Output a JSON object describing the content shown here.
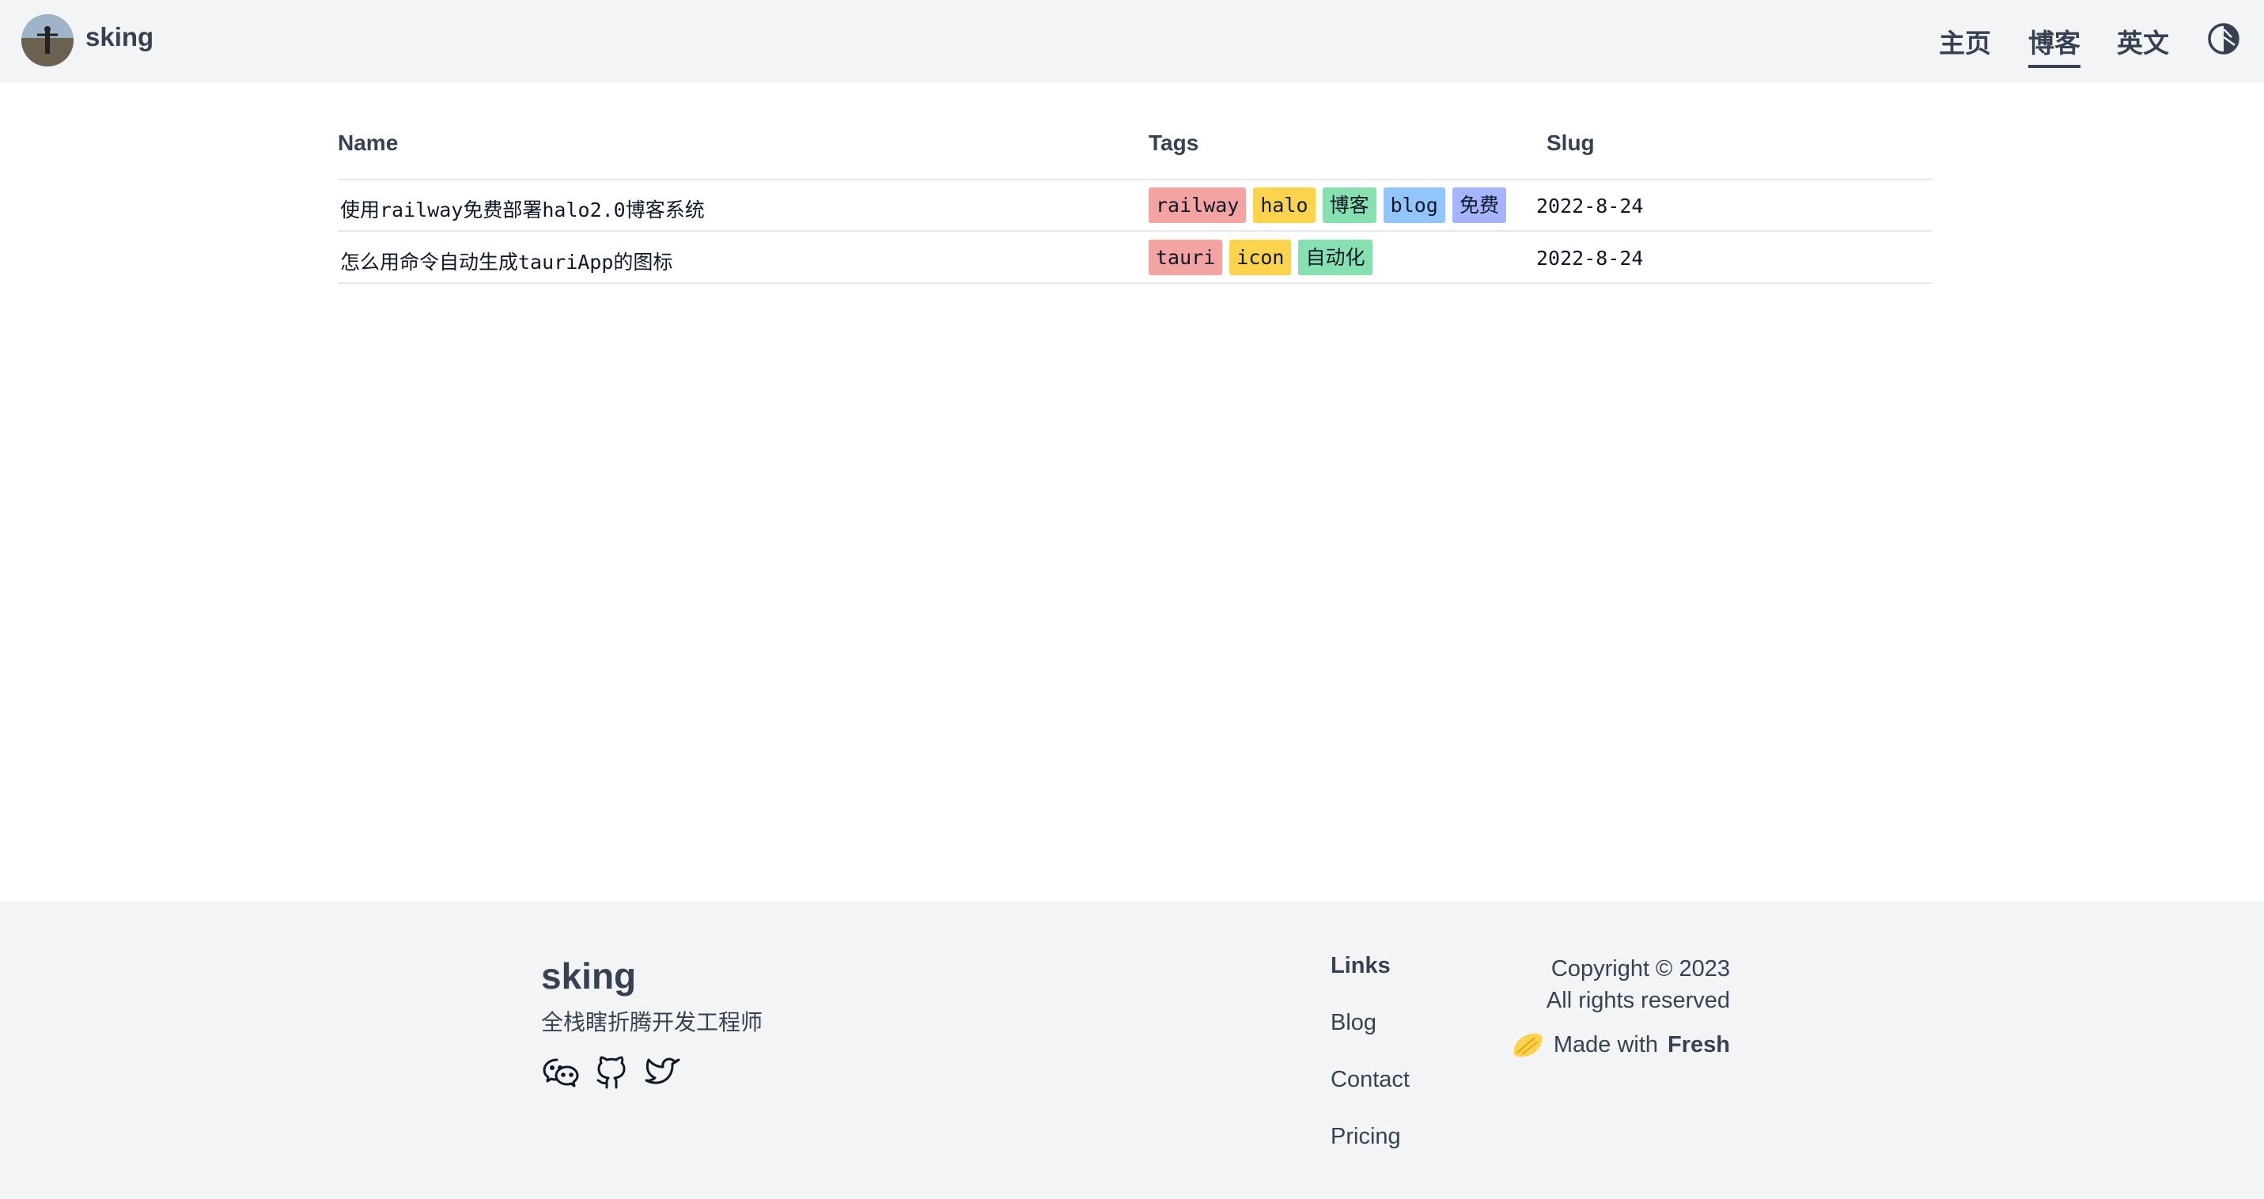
{
  "header": {
    "brand": "sking",
    "nav": [
      {
        "label": "主页",
        "active": false
      },
      {
        "label": "博客",
        "active": true
      },
      {
        "label": "英文",
        "active": false
      }
    ]
  },
  "table": {
    "headers": {
      "name": "Name",
      "tags": "Tags",
      "slug": "Slug"
    },
    "rows": [
      {
        "name": "使用railway免费部署halo2.0博客系统",
        "tags": [
          {
            "label": "railway",
            "color": "#f4a3a3"
          },
          {
            "label": "halo",
            "color": "#fcd34d"
          },
          {
            "label": "博客",
            "color": "#86e0b0"
          },
          {
            "label": "blog",
            "color": "#93c5fd"
          },
          {
            "label": "免费",
            "color": "#a5b4fc"
          }
        ],
        "slug": "2022-8-24"
      },
      {
        "name": "怎么用命令自动生成tauriApp的图标",
        "tags": [
          {
            "label": "tauri",
            "color": "#f4a3a3"
          },
          {
            "label": "icon",
            "color": "#fcd34d"
          },
          {
            "label": "自动化",
            "color": "#86e0b0"
          }
        ],
        "slug": "2022-8-24"
      }
    ]
  },
  "footer": {
    "brand": "sking",
    "subtitle": "全栈瞎折腾开发工程师",
    "socials": [
      "wechat-icon",
      "github-icon",
      "twitter-icon"
    ],
    "links_title": "Links",
    "links": [
      "Blog",
      "Contact",
      "Pricing"
    ],
    "copyright_line1": "Copyright © 2023",
    "copyright_line2": "All rights reserved",
    "made_with_prefix": "Made with",
    "made_with_brand": "Fresh"
  },
  "colors": {
    "header_bg": "#f3f4f6",
    "text": "#374151",
    "lemon": "#fcd34d"
  }
}
